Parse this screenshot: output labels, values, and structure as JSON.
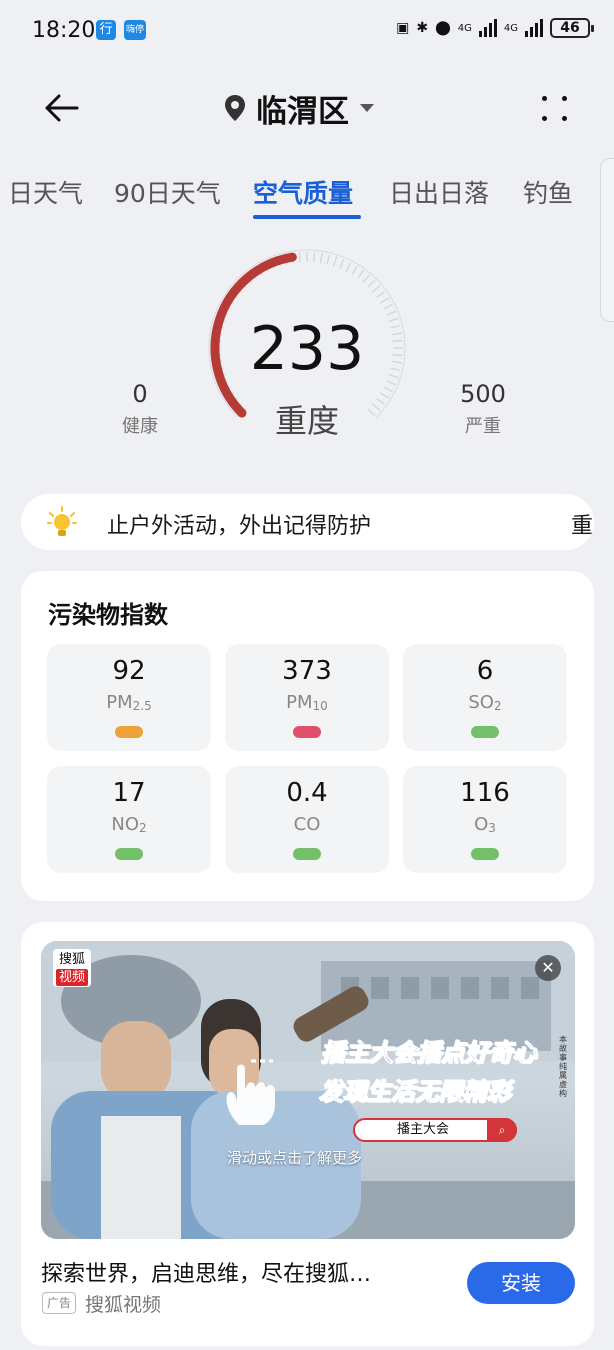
{
  "status_bar": {
    "time": "18:20",
    "badge_1": "行",
    "badge_2": "嗨停",
    "network_1": "4G",
    "network_2": "4G",
    "battery": "46"
  },
  "header": {
    "location": "临渭区"
  },
  "tabs": [
    {
      "label": "日天气"
    },
    {
      "label": "90日天气"
    },
    {
      "label": "空气质量",
      "active": true
    },
    {
      "label": "日出日落"
    },
    {
      "label": "钓鱼"
    }
  ],
  "aqi": {
    "value": "233",
    "level": "重度",
    "min_value": "0",
    "min_label": "健康",
    "max_value": "500",
    "max_label": "严重",
    "fraction": 0.466,
    "arc_color": "#b63a35"
  },
  "tip": {
    "text": "止户外活动，外出记得防护",
    "tail": "重"
  },
  "pollutants": {
    "title": "污染物指数",
    "items": [
      {
        "value": "92",
        "name": "PM",
        "sub": "2.5",
        "color": "#f0a23a"
      },
      {
        "value": "373",
        "name": "PM",
        "sub": "10",
        "color": "#e0506b"
      },
      {
        "value": "6",
        "name": "SO",
        "sub": "2",
        "color": "#74c06a"
      },
      {
        "value": "17",
        "name": "NO",
        "sub": "2",
        "color": "#74c06a"
      },
      {
        "value": "0.4",
        "name": "CO",
        "sub": "",
        "color": "#74c06a"
      },
      {
        "value": "116",
        "name": "O",
        "sub": "3",
        "color": "#74c06a"
      }
    ]
  },
  "ad": {
    "brand_top": "搜狐",
    "brand_bottom": "视频",
    "headline_1": "播主大会播点好奇心",
    "headline_2": "发现生活无限精彩",
    "search_text": "播主大会",
    "hint": "滑动或点击了解更多",
    "vertical_note": "本故事纯属虚构",
    "title": "探索世界，启迪思维，尽在搜狐…",
    "tag": "广告",
    "source": "搜狐视频",
    "install_label": "安装"
  }
}
